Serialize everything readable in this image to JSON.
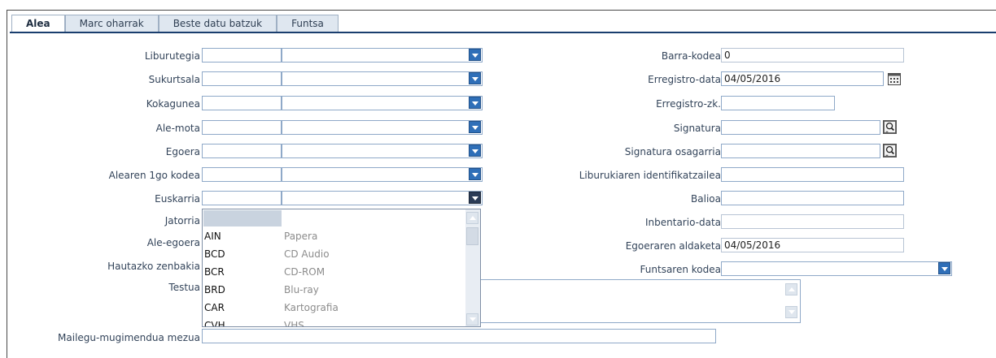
{
  "tabs": [
    {
      "label": "Alea"
    },
    {
      "label": "Marc oharrak"
    },
    {
      "label": "Beste datu batzuk"
    },
    {
      "label": "Funtsa"
    }
  ],
  "left": {
    "liburutegia": {
      "label": "Liburutegia"
    },
    "sukurtsala": {
      "label": "Sukurtsala"
    },
    "kokagunea": {
      "label": "Kokagunea"
    },
    "ale_mota": {
      "label": "Ale-mota"
    },
    "egoera": {
      "label": "Egoera"
    },
    "alearen_1go_kodea": {
      "label": "Alearen 1go kodea"
    },
    "euskarria": {
      "label": "Euskarria"
    },
    "jatorria": {
      "label": "Jatorria"
    },
    "ale_egoera": {
      "label": "Ale-egoera"
    },
    "hautazko_zenbakia": {
      "label": "Hautazko zenbakia"
    },
    "testua": {
      "label": "Testua"
    },
    "mailegu": {
      "label": "Mailegu-mugimendua mezua"
    }
  },
  "right": {
    "barra_kodea": {
      "label": "Barra-kodea",
      "value": "0"
    },
    "erregistro_data": {
      "label": "Erregistro-data",
      "value": "04/05/2016"
    },
    "erregistro_zk": {
      "label": "Erregistro-zk.",
      "value": ""
    },
    "signatura": {
      "label": "Signatura",
      "value": ""
    },
    "signatura_osagarria": {
      "label": "Signatura osagarria",
      "value": ""
    },
    "liburukiaren_id": {
      "label": "Liburukiaren identifikatzailea",
      "value": ""
    },
    "balioa": {
      "label": "Balioa",
      "value": ""
    },
    "inbentario_data": {
      "label": "Inbentario-data",
      "value": ""
    },
    "egoeraren_aldaketa": {
      "label": "Egoeraren aldaketa",
      "value": "04/05/2016"
    },
    "funtsaren_kodea": {
      "label": "Funtsaren kodea",
      "value": ""
    }
  },
  "euskarria_dropdown": {
    "options": [
      {
        "code": "",
        "desc": ""
      },
      {
        "code": "AIN",
        "desc": "Papera"
      },
      {
        "code": "BCD",
        "desc": "CD Audio"
      },
      {
        "code": "BCR",
        "desc": "CD-ROM"
      },
      {
        "code": "BRD",
        "desc": "Blu-ray"
      },
      {
        "code": "CAR",
        "desc": "Kartografia"
      },
      {
        "code": "CVH",
        "desc": "VHS"
      }
    ]
  },
  "colors": {
    "accent": "#2f6fb8",
    "tab_line": "#1a3e6e",
    "input_border": "#8fa9c8"
  }
}
